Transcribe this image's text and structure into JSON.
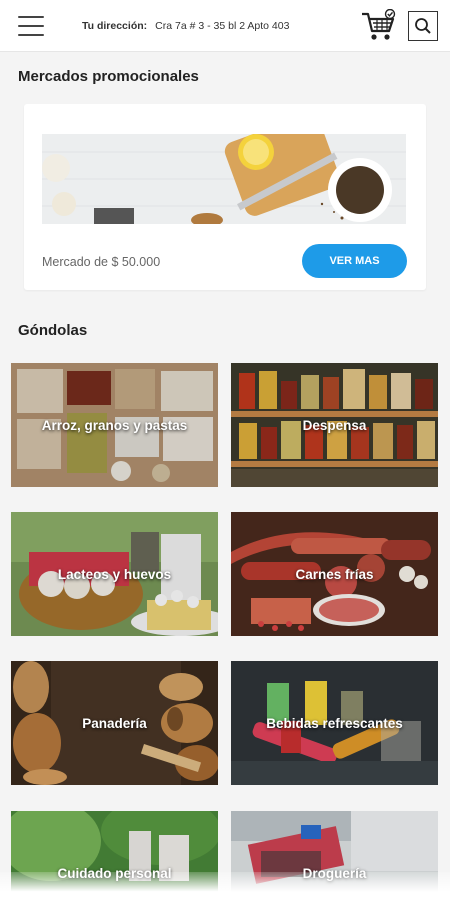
{
  "header": {
    "address_label": "Tu dirección:",
    "address_value": "Cra 7a # 3 - 35 bl 2 Apto 403",
    "icons": {
      "menu": "hamburger-menu-icon",
      "cart": "shopping-cart-icon",
      "search": "search-icon"
    }
  },
  "promos": {
    "title": "Mercados promocionales",
    "card": {
      "text": "Mercado de $ 50.000",
      "button": "VER MAS"
    }
  },
  "gondolas": {
    "title": "Góndolas",
    "items": [
      {
        "label": "Arroz, granos y pastas"
      },
      {
        "label": "Despensa"
      },
      {
        "label": "Lacteos y huevos"
      },
      {
        "label": "Carnes frías"
      },
      {
        "label": "Panadería"
      },
      {
        "label": "Bebidas refrescantes"
      },
      {
        "label": "Cuidado personal"
      },
      {
        "label": "Droguería"
      }
    ]
  },
  "colors": {
    "accent": "#1e9be8",
    "background": "#f4f4f4",
    "card": "#ffffff"
  }
}
